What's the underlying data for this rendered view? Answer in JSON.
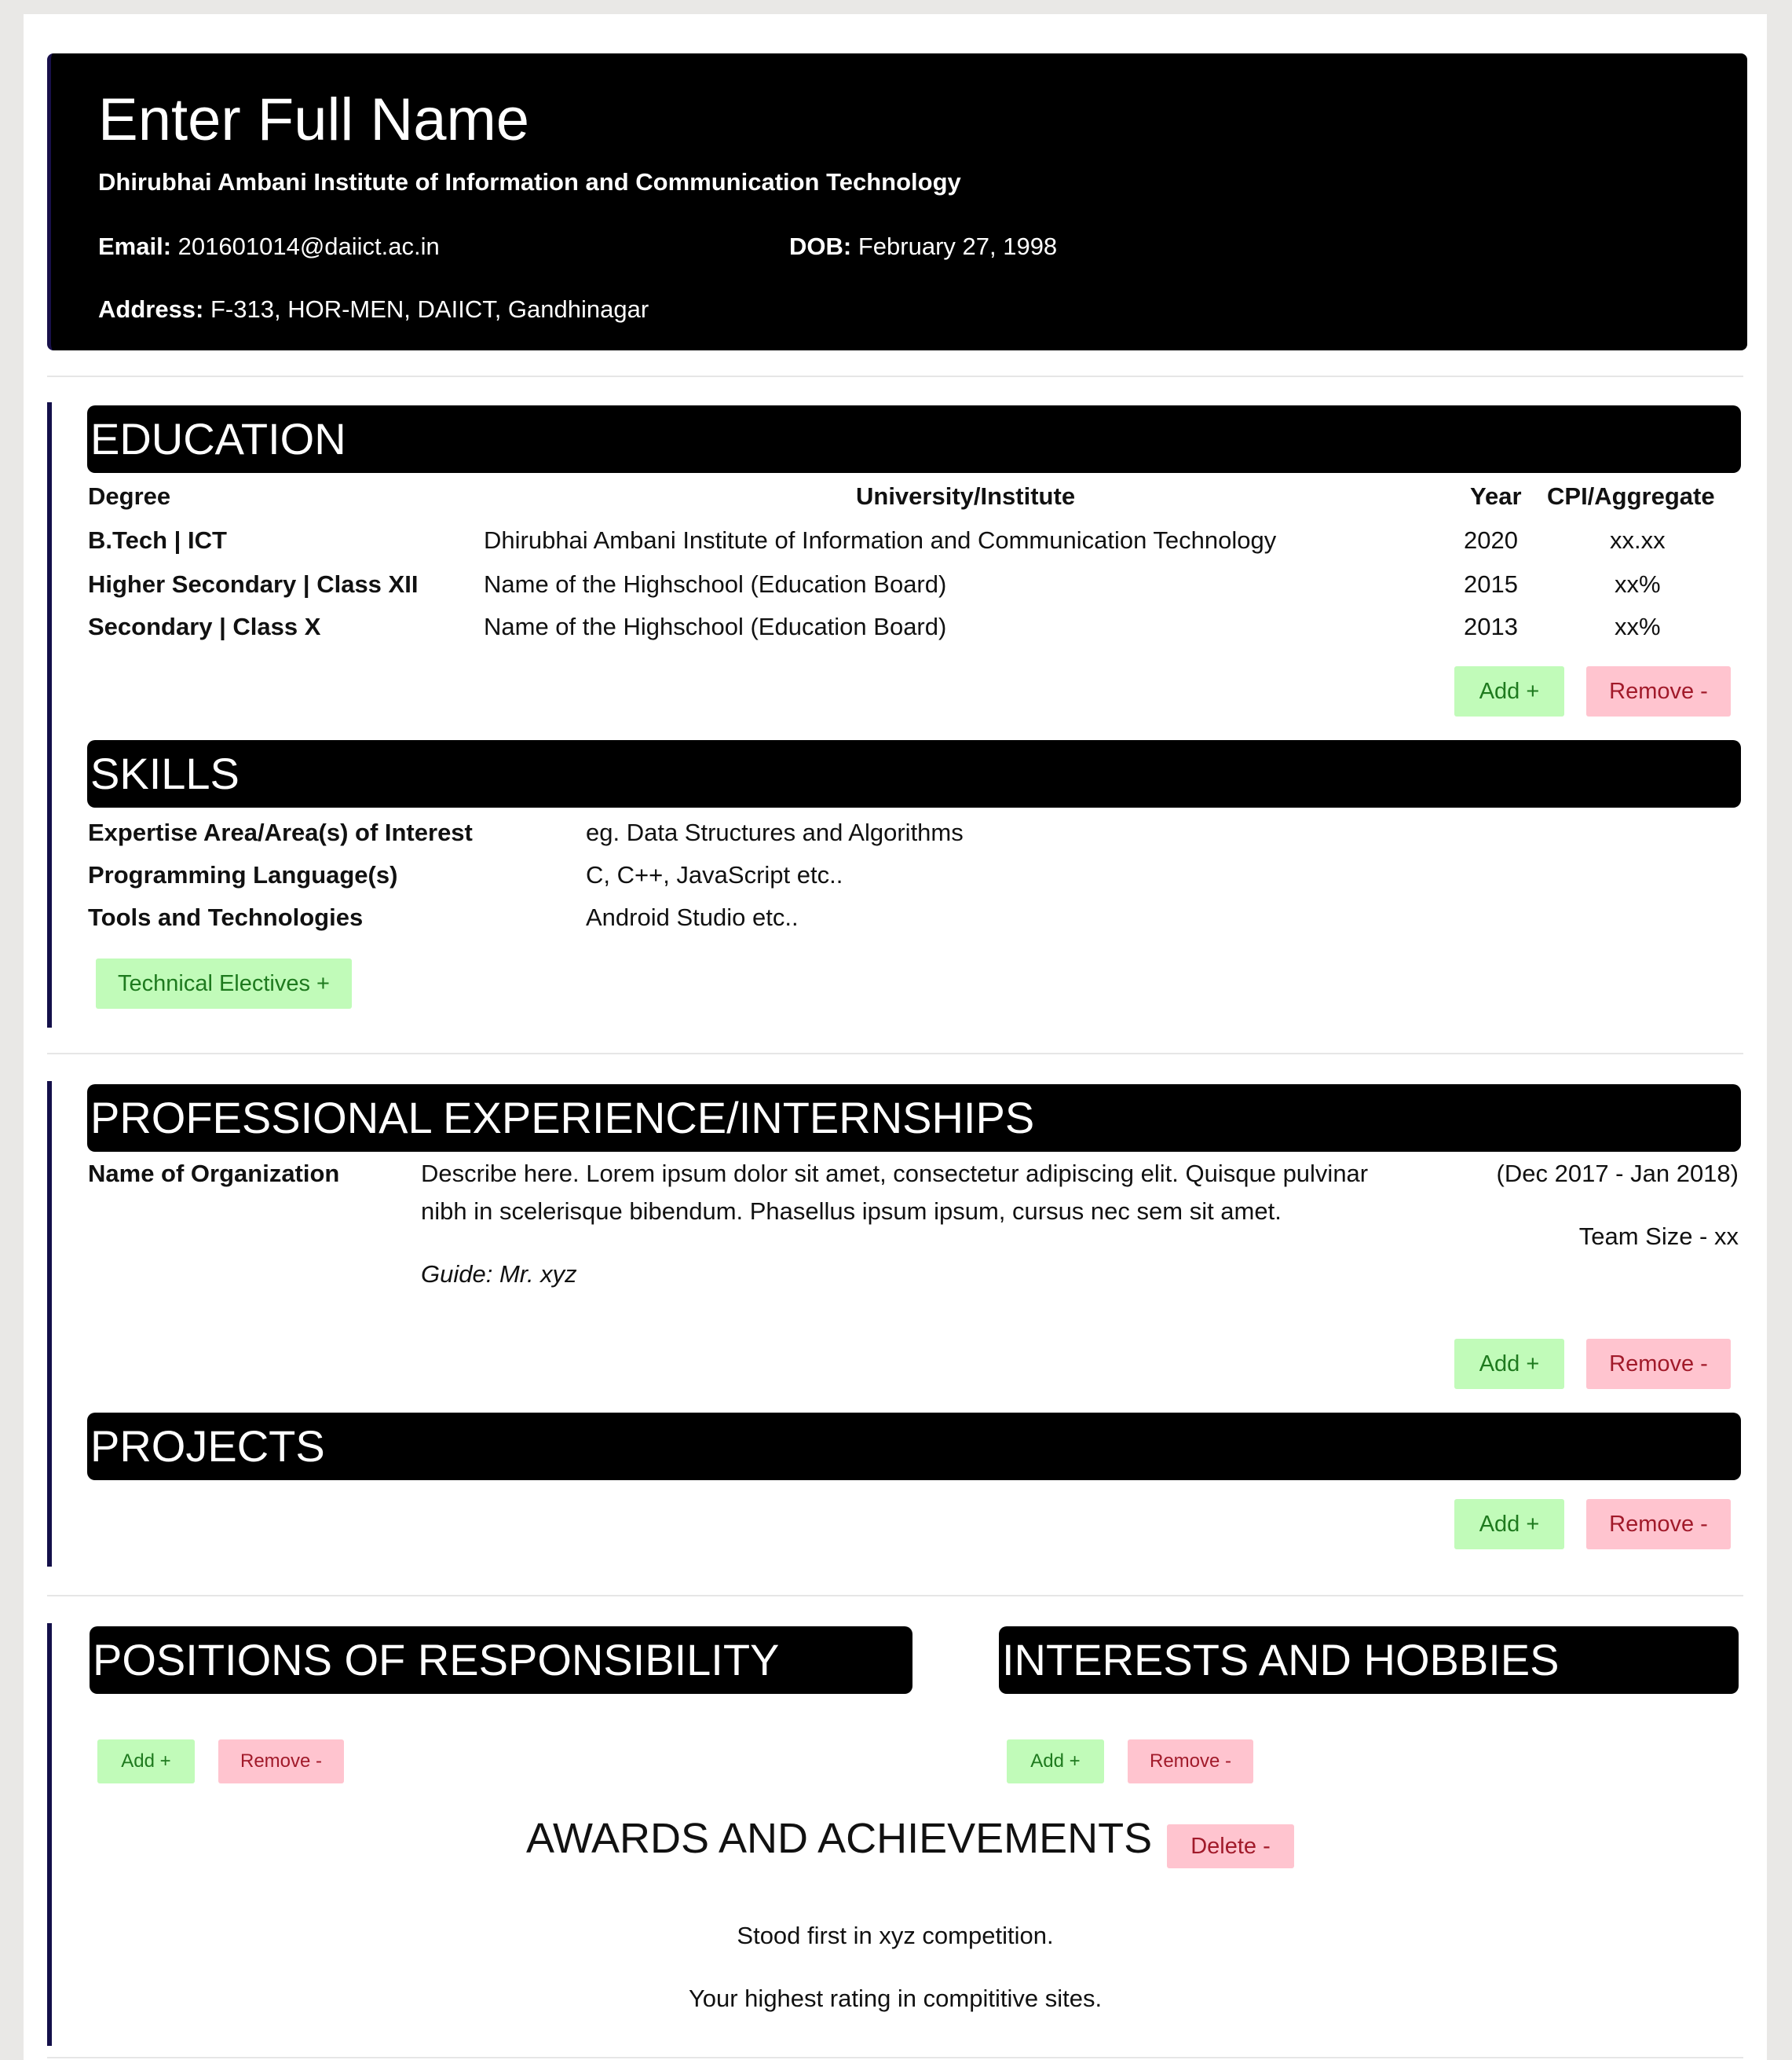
{
  "header": {
    "name": "Enter Full Name",
    "institute": "Dhirubhai Ambani Institute of Information and Communication Technology",
    "email_label": "Email:",
    "email": "201601014@daiict.ac.in",
    "dob_label": "DOB:",
    "dob": "February 27, 1998",
    "address_label": "Address:",
    "address": "F-313, HOR-MEN, DAIICT, Gandhinagar"
  },
  "education": {
    "title": "EDUCATION",
    "columns": [
      "Degree",
      "University/Institute",
      "Year",
      "CPI/Aggregate"
    ],
    "rows": [
      {
        "degree": "B.Tech | ICT",
        "institute": "Dhirubhai Ambani Institute of Information and Communication Technology",
        "year": "2020",
        "score": "xx.xx"
      },
      {
        "degree": "Higher Secondary | Class XII",
        "institute": "Name of the Highschool (Education Board)",
        "year": "2015",
        "score": "xx%"
      },
      {
        "degree": "Secondary | Class X",
        "institute": "Name of the Highschool (Education Board)",
        "year": "2013",
        "score": "xx%"
      }
    ],
    "add_label": "Add +",
    "remove_label": "Remove -"
  },
  "skills": {
    "title": "SKILLS",
    "rows": [
      {
        "label": "Expertise Area/Area(s) of Interest",
        "value": "eg. Data Structures and Algorithms"
      },
      {
        "label": "Programming Language(s)",
        "value": "C, C++, JavaScript etc.."
      },
      {
        "label": "Tools and Technologies",
        "value": "Android Studio etc.."
      }
    ],
    "electives_label": "Technical Electives +"
  },
  "experience": {
    "title": "PROFESSIONAL EXPERIENCE/INTERNSHIPS",
    "org": "Name of Organization",
    "desc_line1": "Describe here. Lorem ipsum dolor sit amet, consectetur adipiscing elit. Quisque pulvinar",
    "desc_line2": "nibh in scelerisque bibendum. Phasellus ipsum ipsum, cursus nec sem sit amet.",
    "guide": "Guide: Mr. xyz",
    "dates": "(Dec 2017 - Jan 2018)",
    "team": "Team Size - xx",
    "add_label": "Add +",
    "remove_label": "Remove -"
  },
  "projects": {
    "title": "PROJECTS",
    "add_label": "Add +",
    "remove_label": "Remove -"
  },
  "positions": {
    "title": "POSITIONS OF RESPONSIBILITY",
    "add_label": "Add +",
    "remove_label": "Remove -"
  },
  "interests": {
    "title": "INTERESTS AND HOBBIES",
    "add_label": "Add +",
    "remove_label": "Remove -"
  },
  "awards": {
    "title": "AWARDS AND ACHIEVEMENTS",
    "delete_label": "Delete -",
    "items": [
      "Stood first in xyz competition.",
      "Your highest rating in compititive sites."
    ]
  },
  "colors": {
    "header_bg": "#000000",
    "accent_bar": "#14104a",
    "add_bg": "#c1fbb9",
    "remove_bg": "#ffc4cf"
  }
}
